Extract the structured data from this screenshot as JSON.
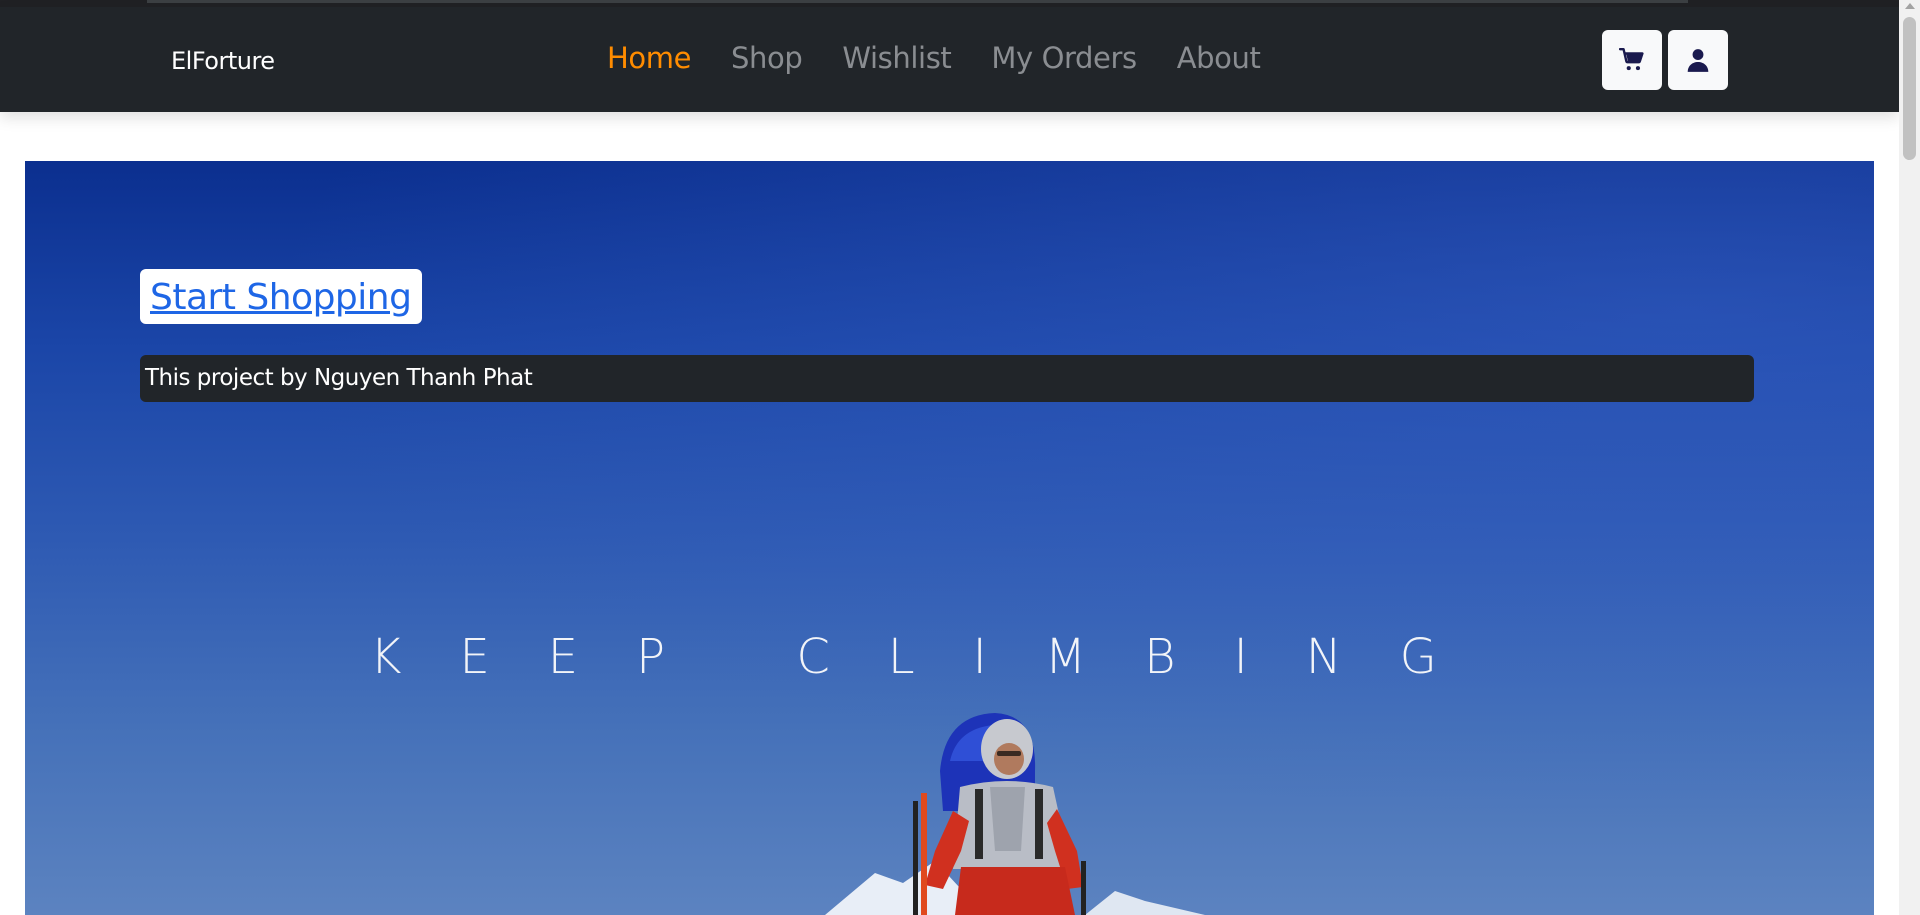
{
  "navbar": {
    "brand": "ElForture",
    "links": [
      {
        "label": "Home",
        "active": true
      },
      {
        "label": "Shop",
        "active": false
      },
      {
        "label": "Wishlist",
        "active": false
      },
      {
        "label": "My Orders",
        "active": false
      },
      {
        "label": "About",
        "active": false
      }
    ],
    "buttons": [
      {
        "icon": "shopping-cart-icon"
      },
      {
        "icon": "user-icon"
      }
    ]
  },
  "hero": {
    "cta_label": "Start Shopping",
    "caption": "This project by Nguyen Thanh Phat",
    "slogan": "KEEP CLIMBING",
    "image_subject": "climber-with-backpack"
  },
  "colors": {
    "navbar_bg": "#212529",
    "active_link": "#ff8c00",
    "inactive_link": "#8a8d91",
    "cta_text": "#1e66e6",
    "hero_sky": "#1b46a8"
  }
}
